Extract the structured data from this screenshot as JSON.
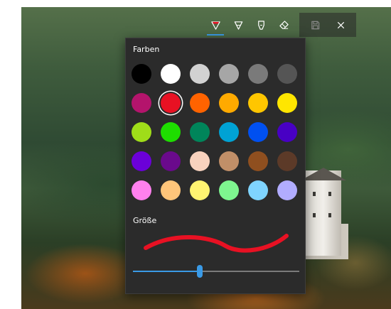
{
  "toolbar": {
    "tools": [
      {
        "name": "ballpoint-pen",
        "active": true,
        "ink": "#e81123"
      },
      {
        "name": "pencil",
        "active": false
      },
      {
        "name": "highlighter",
        "active": false
      },
      {
        "name": "eraser",
        "active": false
      },
      {
        "name": "save",
        "active": false
      },
      {
        "name": "close",
        "active": false
      }
    ]
  },
  "panel": {
    "colors_label": "Farben",
    "size_label": "Größe",
    "selected_color": "#e81123",
    "size_level": 0.4,
    "accent": "#3a9ae6",
    "colors": [
      "#000000",
      "#ffffff",
      "#d1d1d1",
      "#a6a6a6",
      "#7a7a7a",
      "#555555",
      "#b4146c",
      "#e81123",
      "#ff6300",
      "#ffaa00",
      "#ffc600",
      "#ffe600",
      "#9fdd19",
      "#1edd00",
      "#00855a",
      "#00a2d4",
      "#0050f0",
      "#4800c4",
      "#6b00d9",
      "#6a0a8c",
      "#f8d2be",
      "#c18f68",
      "#8f4f1f",
      "#5c3a28",
      "#ff80ee",
      "#ffc57a",
      "#fff471",
      "#7ef58f",
      "#7fd4ff",
      "#b1acff"
    ]
  }
}
